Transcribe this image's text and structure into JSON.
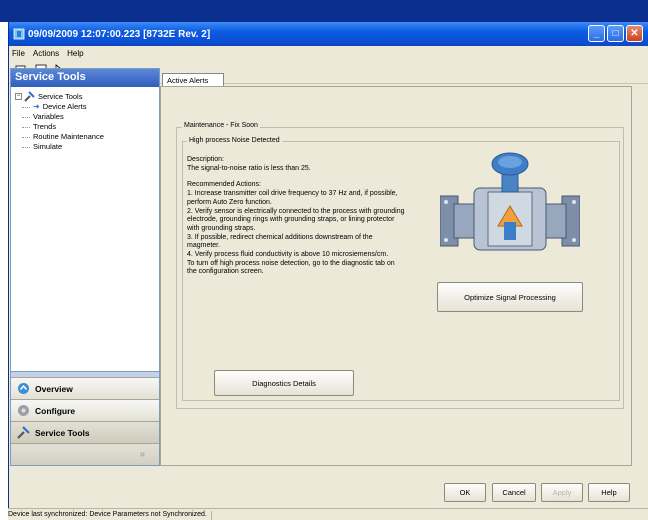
{
  "window": {
    "title": "09/09/2009 12:07:00.223 [8732E Rev. 2]",
    "controls": [
      "minimize",
      "maximize",
      "close"
    ]
  },
  "menu": [
    "File",
    "Actions",
    "Help"
  ],
  "toolbar": {
    "icons": [
      "print-icon",
      "print-preview-icon",
      "context-help-icon"
    ]
  },
  "sidebar": {
    "header": "Service Tools",
    "tree": {
      "root": "Service Tools",
      "items": [
        "Device Alerts",
        "Variables",
        "Trends",
        "Routine Maintenance",
        "Simulate"
      ],
      "selected": "Device Alerts"
    },
    "nav": [
      {
        "label": "Overview",
        "icon": "overview-icon"
      },
      {
        "label": "Configure",
        "icon": "configure-icon"
      },
      {
        "label": "Service Tools",
        "icon": "service-tools-icon",
        "selected": true
      }
    ]
  },
  "tab": "Active Alerts",
  "alert": {
    "group": "Maintenance - Fix Soon",
    "title": "High process Noise Detected",
    "description_heading": "Description:",
    "description": "The signal-to-noise ratio is less than 25.",
    "actions_heading": "Recommended Actions:",
    "actions": [
      "1. Increase transmitter coil drive frequency to 37 Hz and, if possible, perform Auto Zero function.",
      "2. Verify sensor is electrically connected to the process with grounding electrode, grounding rings with grounding straps, or lining protector with grounding straps.",
      "3. If possible, redirect chemical additions downstream of the magmeter.",
      "4. Verify process fluid conductivity is above 10 microsiemens/cm.",
      "To turn off high process noise detection, go to the diagnostic tab on the configuration screen."
    ]
  },
  "buttons": {
    "optimize": "Optimize Signal Processing",
    "diagnostics": "Diagnostics Details",
    "ok": "OK",
    "cancel": "Cancel",
    "apply": "Apply",
    "help": "Help"
  },
  "status": "Device last synchronized: Device Parameters not Synchronized.",
  "colors": {
    "title_blue": "#0a4fd3",
    "sidebar_header": "#2f5fbd",
    "window_bg": "#ece9d8"
  }
}
